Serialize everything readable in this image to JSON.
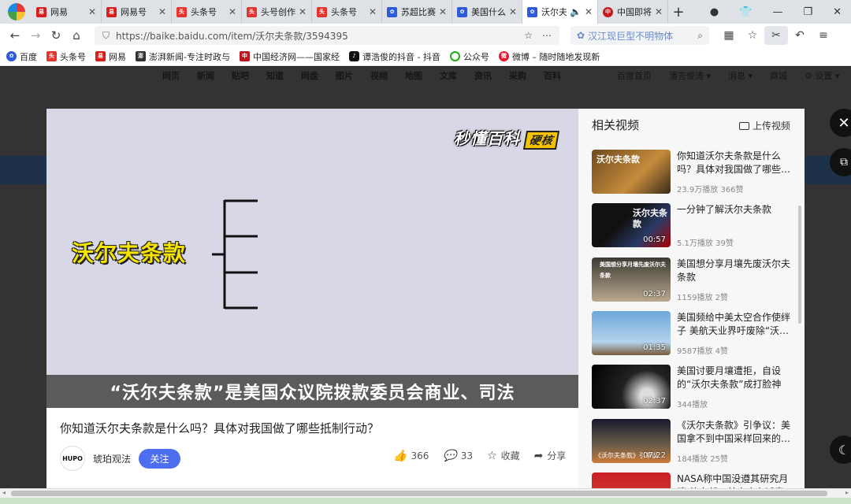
{
  "tabs": [
    {
      "title": "网易",
      "favicon": "netease"
    },
    {
      "title": "网易号",
      "favicon": "netease"
    },
    {
      "title": "头条号",
      "favicon": "toutiao"
    },
    {
      "title": "头号创作",
      "favicon": "toutiao"
    },
    {
      "title": "头条号",
      "favicon": "toutiao"
    },
    {
      "title": "苏超比赛",
      "favicon": "baidu"
    },
    {
      "title": "美国什么",
      "favicon": "baidu"
    },
    {
      "title": "沃尔夫",
      "favicon": "baidu",
      "active": true
    },
    {
      "title": "中国即将",
      "favicon": "cctv"
    }
  ],
  "navbar": {
    "url": "https://baike.baidu.com/item/沃尔夫条款/3594395",
    "search_text": "汉江现巨型不明物体"
  },
  "bookmarks": [
    {
      "label": "百度",
      "favicon": "baidu"
    },
    {
      "label": "头条号",
      "favicon": "toutiao"
    },
    {
      "label": "网易",
      "favicon": "netease"
    },
    {
      "label": "澎湃新闻-专注时政与",
      "favicon": "thepaper"
    },
    {
      "label": "中国经济网——国家经",
      "favicon": "ce"
    },
    {
      "label": "谭浩俊的抖音 - 抖音",
      "favicon": "douyin"
    },
    {
      "label": "公众号",
      "favicon": "wechat"
    },
    {
      "label": "微博 – 随时随地发现新",
      "favicon": "weibo"
    }
  ],
  "site_nav": {
    "left": [
      "网页",
      "新闻",
      "贴吧",
      "知道",
      "网盘",
      "图片",
      "视频",
      "地图",
      "文库",
      "资讯",
      "采购",
      "百科"
    ],
    "right": [
      "百度首页",
      "潘吉俊涛 ▾",
      "消息 ▾",
      "商城",
      "⚙ 设置 ▾"
    ]
  },
  "video": {
    "brand": "秒懂百科",
    "brand_tag": "硬核",
    "title_overlay": "沃尔夫条款",
    "subtitle": "“沃尔夫条款”是美国众议院拨款委员会商业、司法",
    "title": "你知道沃尔夫条款是什么吗？具体对我国做了哪些抵制行动？",
    "author": {
      "name": "琥珀观法",
      "avatar_text": "HUPO",
      "follow_label": "关注"
    },
    "actions": {
      "likes": "366",
      "comments": "33",
      "collect_label": "收藏",
      "share_label": "分享"
    }
  },
  "related": {
    "heading": "相关视频",
    "upload_label": "上传视频",
    "items": [
      {
        "title": "你知道沃尔夫条款是什么吗？具体对我国做了哪些…",
        "duration": "",
        "views": "23.9万播放",
        "likes": "366赞",
        "thumb_text": "沃尔夫条款"
      },
      {
        "title": "一分钟了解沃尔夫条款",
        "duration": "00:57",
        "views": "5.1万播放",
        "likes": "39赞",
        "thumb_text": "沃尔夫条款"
      },
      {
        "title": "美国想分享月壤先废沃尔夫条款",
        "duration": "02:37",
        "views": "1159播放",
        "likes": "2赞",
        "thumb_text": "美国想分享月壤先废沃尔夫条款"
      },
      {
        "title": "美国频给中美太空合作使绊子 美航天业界吁废除“沃…",
        "duration": "01:35",
        "views": "9587播放",
        "likes": "4赞",
        "thumb_text": ""
      },
      {
        "title": "美国讨要月壤遭拒，自设的“沃尔夫条款”成打脸神器?",
        "duration": "02:37",
        "views": "344播放",
        "likes": "",
        "thumb_text": ""
      },
      {
        "title": "《沃尔夫条款》引争议：美国拿不到中国采样回来的…",
        "duration": "07:22",
        "views": "184播放",
        "likes": "25赞",
        "thumb_text": "《沃尔夫条款》引争议"
      },
      {
        "title": "NASA称中国没遵其研究月壤 外交部：美方应有诚意…",
        "duration": "",
        "views": "",
        "likes": "",
        "thumb_text": ""
      }
    ]
  }
}
